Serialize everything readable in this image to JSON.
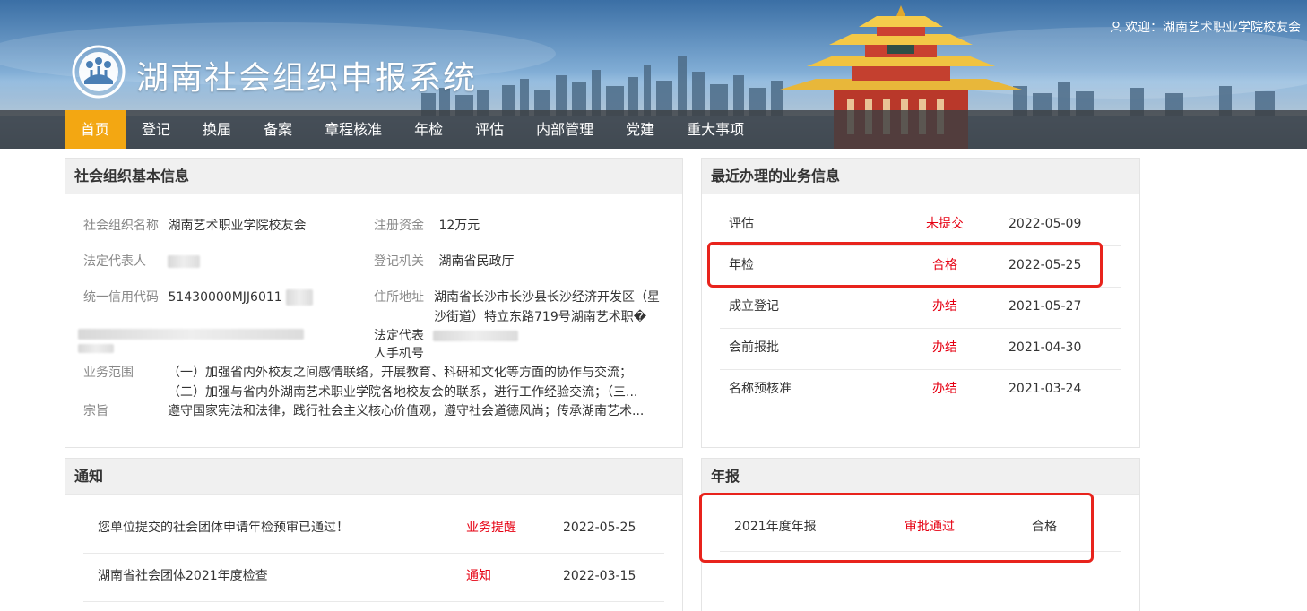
{
  "header": {
    "system_title": "湖南社会组织申报系统",
    "welcome_text": "欢迎：湖南艺术职业学院校友会",
    "user_icon": "user-icon",
    "logo_icon": "org-logo-icon"
  },
  "nav": {
    "items": [
      {
        "label": "首页",
        "active": true
      },
      {
        "label": "登记",
        "active": false
      },
      {
        "label": "换届",
        "active": false
      },
      {
        "label": "备案",
        "active": false
      },
      {
        "label": "章程核准",
        "active": false
      },
      {
        "label": "年检",
        "active": false
      },
      {
        "label": "评估",
        "active": false
      },
      {
        "label": "内部管理",
        "active": false
      },
      {
        "label": "党建",
        "active": false
      },
      {
        "label": "重大事项",
        "active": false
      }
    ],
    "active_color": "#f3a712"
  },
  "basic_info": {
    "title": "社会组织基本信息",
    "org_name_label": "社会组织名称",
    "org_name_value": "湖南艺术职业学院校友会",
    "capital_label": "注册资金",
    "capital_value": "12万元",
    "legal_rep_label": "法定代表人",
    "authority_label": "登记机关",
    "authority_value": "湖南省民政厅",
    "credit_code_label": "统一信用代码",
    "credit_code_value": "51430000MJJ6011",
    "address_label": "住所地址",
    "address_line1": "湖南省长沙市长沙县长沙经济开发区（星",
    "address_line2": "沙街道）特立东路719号湖南艺术职�",
    "legal_phone_label_1": "法定代表",
    "legal_phone_label_2": "人手机号",
    "scope_label": "业务范围",
    "scope_line1": "（一）加强省内外校友之间感情联络，开展教育、科研和文化等方面的协作与交流；",
    "scope_line2": "（二）加强与省内外湖南艺术职业学院各地校友会的联系，进行工作经验交流；（三...",
    "purpose_label": "宗旨",
    "purpose_value": "遵守国家宪法和法律，践行社会主义核心价值观，遵守社会道德风尚；传承湖南艺术..."
  },
  "recent": {
    "title": "最近办理的业务信息",
    "rows": [
      {
        "name": "评估",
        "status": "未提交",
        "date": "2022-05-09"
      },
      {
        "name": "年检",
        "status": "合格",
        "date": "2022-05-25"
      },
      {
        "name": "成立登记",
        "status": "办结",
        "date": "2021-05-27"
      },
      {
        "name": "会前报批",
        "status": "办结",
        "date": "2021-04-30"
      },
      {
        "name": "名称预核准",
        "status": "办结",
        "date": "2021-03-24"
      }
    ]
  },
  "notice": {
    "title": "通知",
    "rows": [
      {
        "title": "您单位提交的社会团体申请年检预审已通过！",
        "tag": "业务提醒",
        "date": "2022-05-25"
      },
      {
        "title": "湖南省社会团体2021年度检查",
        "tag": "通知",
        "date": "2022-03-15"
      }
    ]
  },
  "annual": {
    "title": "年报",
    "rows": [
      {
        "year": "2021年度年报",
        "status": "审批通过",
        "result": "合格"
      }
    ]
  },
  "colors": {
    "status_red": "#e60012",
    "highlight_red": "#e8231c",
    "panel_head_bg": "#f0f0f0"
  }
}
